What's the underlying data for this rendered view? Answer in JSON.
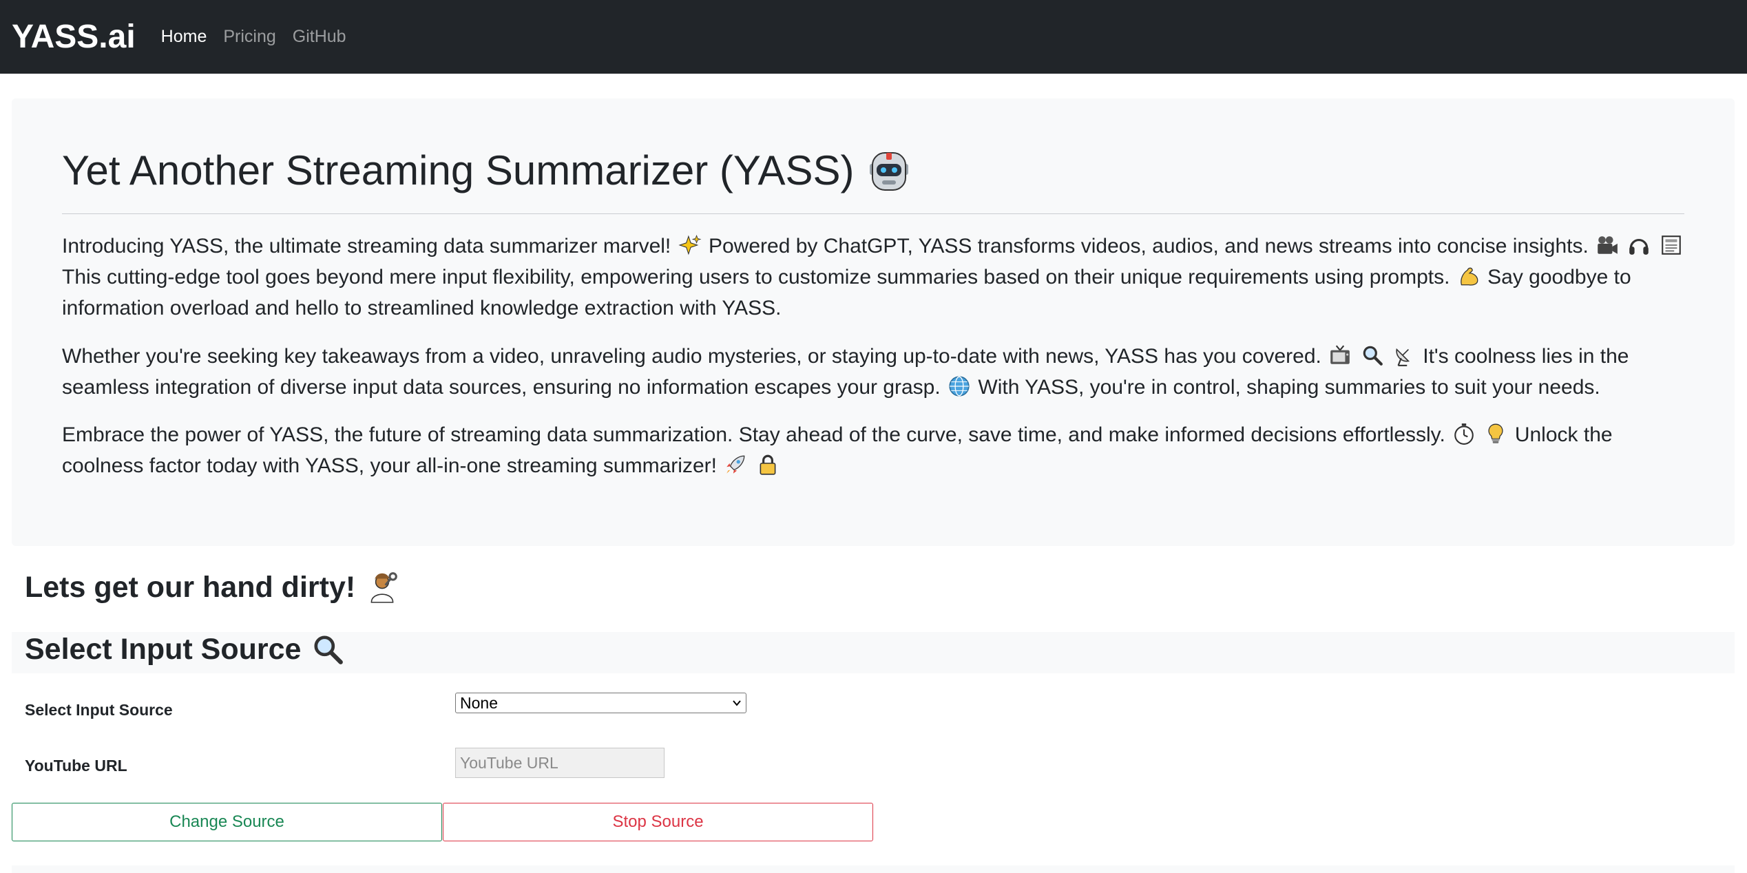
{
  "navbar": {
    "brand": "YASS.ai",
    "links": [
      {
        "label": "Home",
        "active": true
      },
      {
        "label": "Pricing",
        "active": false
      },
      {
        "label": "GitHub",
        "active": false
      }
    ]
  },
  "hero": {
    "title": "Yet Another Streaming Summarizer (YASS)",
    "title_icon": "robot-icon",
    "p1": {
      "a": "Introducing YASS, the ultimate streaming data summarizer marvel!",
      "b": "Powered by ChatGPT, YASS transforms videos, audios, and news streams into concise insights.",
      "c": "This cutting-edge tool goes beyond mere input flexibility, empowering users to customize summaries based on their unique requirements using prompts.",
      "d": "Say goodbye to information overload and hello to streamlined knowledge extraction with YASS."
    },
    "p2": {
      "a": "Whether you're seeking key takeaways from a video, unraveling audio mysteries, or staying up-to-date with news, YASS has you covered.",
      "b": "It's coolness lies in the seamless integration of diverse input data sources, ensuring no information escapes your grasp.",
      "c": "With YASS, you're in control, shaping summaries to suit your needs."
    },
    "p3": {
      "a": "Embrace the power of YASS, the future of streaming data summarization. Stay ahead of the curve, save time, and make informed decisions effortlessly.",
      "b": "Unlock the coolness factor today with YASS, your all-in-one streaming summarizer!"
    }
  },
  "section_dirty": {
    "title": "Lets get our hand dirty!",
    "icon": "mechanic-icon"
  },
  "section_select": {
    "title": "Select Input Source",
    "icon": "magnifier-icon"
  },
  "form": {
    "source_label": "Select Input Source",
    "source_value": "None",
    "url_label": "YouTube URL",
    "url_placeholder": "YouTube URL",
    "url_value": ""
  },
  "buttons": {
    "change": "Change Source",
    "stop": "Stop Source"
  },
  "colors": {
    "navbar_bg": "#212529",
    "panel_bg": "#f8f9fa",
    "success": "#198754",
    "danger": "#dc3545"
  }
}
